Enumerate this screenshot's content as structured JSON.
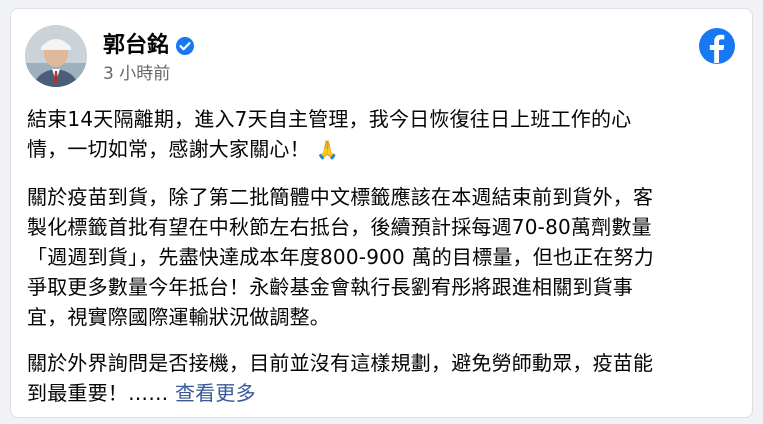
{
  "post": {
    "author": "郭台銘",
    "time": "3 小時前",
    "paragraphs": [
      "結束14天隔離期，進入7天自主管理，我今日恢復往日上班工作的心\n情，一切如常，感謝大家關心！",
      "關於疫苗到貨，除了第二批簡體中文標籤應該在本週結束前到貨外，客\n製化標籤首批有望在中秋節左右抵台，後續預計採每週70-80萬劑數量\n「週週到貨」，先盡快達成本年度800-900 萬的目標量，但也正在努力\n爭取更多數量今年抵台！永齡基金會執行長劉宥彤將跟進相關到貨事\n宜，視實際國際運輸狀況做調整。",
      "關於外界詢問是否接機，目前並沒有這樣規劃，避免勞師動眾，疫苗能\n到最重要！……"
    ],
    "pray_emoji": "🙏",
    "see_more": "查看更多"
  },
  "colors": {
    "facebook_blue": "#1877f2",
    "link": "#385898",
    "muted": "#65676b"
  },
  "icons": [
    "verified-badge-icon",
    "facebook-logo-icon"
  ]
}
